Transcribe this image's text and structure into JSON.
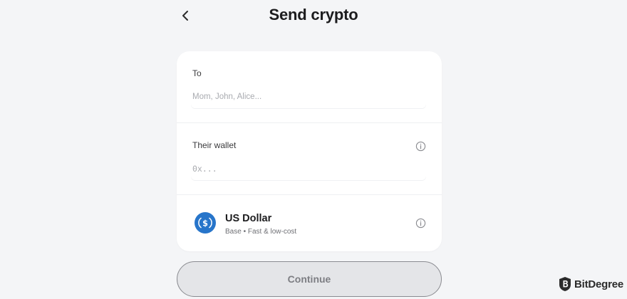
{
  "header": {
    "title": "Send crypto",
    "back_icon": "chevron-left-icon"
  },
  "form": {
    "to": {
      "label": "To",
      "placeholder": "Mom, John, Alice...",
      "value": ""
    },
    "wallet": {
      "label": "Their wallet",
      "placeholder": "0x...",
      "value": "",
      "info_icon": "info-icon"
    },
    "asset": {
      "name": "US Dollar",
      "subtitle": "Base • Fast & low-cost",
      "icon": "usdc-coin-icon",
      "info_icon": "info-icon"
    }
  },
  "continue_label": "Continue",
  "watermark": {
    "text": "BitDegree"
  },
  "colors": {
    "background": "#f4f5f7",
    "card": "#ffffff",
    "usdc_blue": "#2775ca",
    "button_disabled_bg": "#e4e5e8",
    "button_disabled_text": "#7d7e83"
  }
}
